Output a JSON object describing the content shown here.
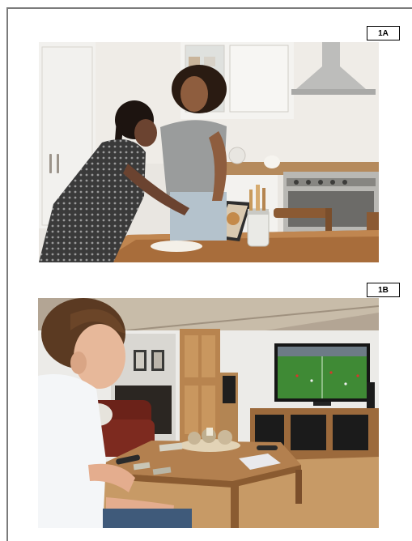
{
  "figures": [
    {
      "label": "1A",
      "subject": "kitchen-baking-scene"
    },
    {
      "label": "1B",
      "subject": "living-room-football-tv-scene"
    }
  ],
  "colors": {
    "frame": "#7b7b7b",
    "label_border": "#000000"
  }
}
